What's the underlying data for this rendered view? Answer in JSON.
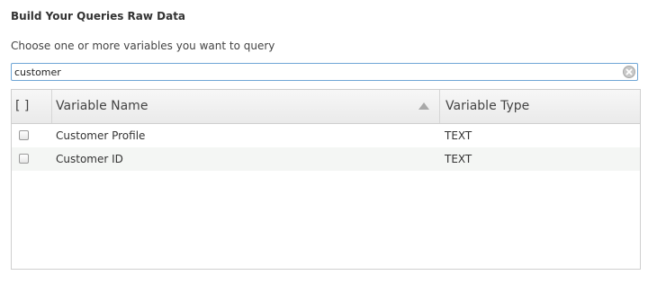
{
  "header": {
    "title": "Build Your Queries Raw Data",
    "prompt": "Choose one or more variables you want to query"
  },
  "search": {
    "value": "customer",
    "clear_icon": "clear-circle-icon"
  },
  "grid": {
    "columns": [
      {
        "label": "[ ]"
      },
      {
        "label": "Variable Name",
        "sort": "ascending"
      },
      {
        "label": "Variable Type"
      }
    ],
    "rows": [
      {
        "checked": false,
        "name": "Customer Profile",
        "type": "TEXT"
      },
      {
        "checked": false,
        "name": "Customer ID",
        "type": "TEXT"
      }
    ]
  },
  "colors": {
    "search_border": "#6fa6d6",
    "alt_row": "#f4f6f4",
    "grid_border": "#cfcfcf"
  }
}
